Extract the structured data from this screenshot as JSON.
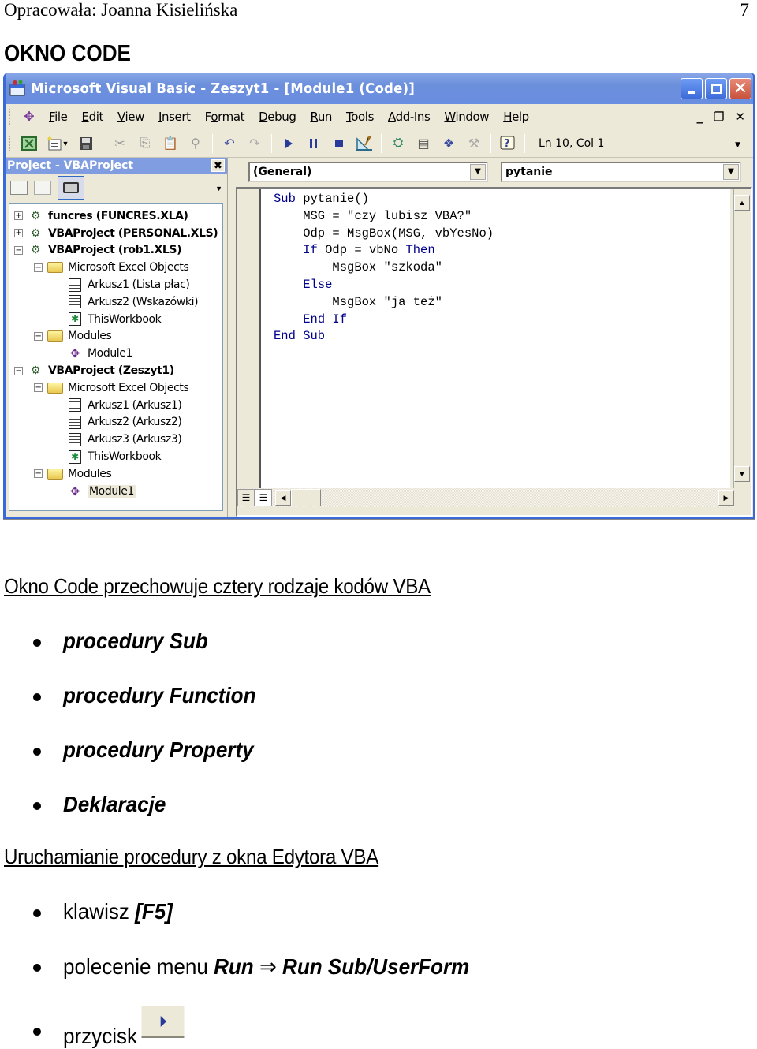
{
  "page": {
    "author": "Opracowała: Joanna Kisielińska",
    "page_number": "7",
    "section_title": "OKNO CODE"
  },
  "vbe": {
    "title": "Microsoft Visual Basic - Zeszyt1 - [Module1 (Code)]",
    "menu": [
      "File",
      "Edit",
      "View",
      "Insert",
      "Format",
      "Debug",
      "Run",
      "Tools",
      "Add-Ins",
      "Window",
      "Help"
    ],
    "menu_access_keys": [
      "F",
      "E",
      "V",
      "I",
      "o",
      "D",
      "R",
      "T",
      "A",
      "W",
      "H"
    ],
    "status": "Ln 10, Col 1",
    "project_pane": {
      "title": "Project - VBAProject",
      "tree": [
        {
          "level": 0,
          "expander": "+",
          "icon": "vba-project-icon",
          "label": "funcres (FUNCRES.XLA)",
          "bold": true
        },
        {
          "level": 0,
          "expander": "+",
          "icon": "vba-project-icon",
          "label": "VBAProject (PERSONAL.XLS)",
          "bold": true
        },
        {
          "level": 0,
          "expander": "-",
          "icon": "vba-project-icon",
          "label": "VBAProject (rob1.XLS)",
          "bold": true
        },
        {
          "level": 1,
          "expander": "-",
          "icon": "folder-icon",
          "label": "Microsoft Excel Objects"
        },
        {
          "level": 2,
          "expander": "",
          "icon": "worksheet-icon",
          "label": "Arkusz1 (Lista płac)"
        },
        {
          "level": 2,
          "expander": "",
          "icon": "worksheet-icon",
          "label": "Arkusz2 (Wskazówki)"
        },
        {
          "level": 2,
          "expander": "",
          "icon": "workbook-icon",
          "label": "ThisWorkbook"
        },
        {
          "level": 1,
          "expander": "-",
          "icon": "folder-icon",
          "label": "Modules"
        },
        {
          "level": 2,
          "expander": "",
          "icon": "module-icon",
          "label": "Module1"
        },
        {
          "level": 0,
          "expander": "-",
          "icon": "vba-project-icon",
          "label": "VBAProject (Zeszyt1)",
          "bold": true
        },
        {
          "level": 1,
          "expander": "-",
          "icon": "folder-icon",
          "label": "Microsoft Excel Objects"
        },
        {
          "level": 2,
          "expander": "",
          "icon": "worksheet-icon",
          "label": "Arkusz1 (Arkusz1)"
        },
        {
          "level": 2,
          "expander": "",
          "icon": "worksheet-icon",
          "label": "Arkusz2 (Arkusz2)"
        },
        {
          "level": 2,
          "expander": "",
          "icon": "worksheet-icon",
          "label": "Arkusz3 (Arkusz3)"
        },
        {
          "level": 2,
          "expander": "",
          "icon": "workbook-icon",
          "label": "ThisWorkbook"
        },
        {
          "level": 1,
          "expander": "-",
          "icon": "folder-icon",
          "label": "Modules"
        },
        {
          "level": 2,
          "expander": "",
          "icon": "module-icon",
          "label": "Module1",
          "selected": true
        }
      ]
    },
    "code_pane": {
      "object_combo": "(General)",
      "procedure_combo": "pytanie",
      "lines": [
        [
          {
            "t": "Sub",
            "kw": true
          },
          {
            "t": " pytanie()"
          }
        ],
        [
          {
            "t": "    MSG = \"czy lubisz VBA?\""
          }
        ],
        [
          {
            "t": "    Odp = MsgBox(MSG, vbYesNo)"
          }
        ],
        [
          {
            "t": "    "
          },
          {
            "t": "If",
            "kw": true
          },
          {
            "t": " Odp = vbNo "
          },
          {
            "t": "Then",
            "kw": true
          }
        ],
        [
          {
            "t": "        MsgBox \"szkoda\""
          }
        ],
        [
          {
            "t": "    "
          },
          {
            "t": "Else",
            "kw": true
          }
        ],
        [
          {
            "t": "        MsgBox \"ja też\""
          }
        ],
        [
          {
            "t": "    "
          },
          {
            "t": "End If",
            "kw": true
          }
        ],
        [
          {
            "t": "End Sub",
            "kw": true
          }
        ]
      ]
    },
    "colors": {
      "titlebar": "#6c8fdc",
      "chrome": "#ece9d8",
      "keyword": "#00008b"
    }
  },
  "doc": {
    "heading1": "Okno Code przechowuje cztery rodzaje kodów VBA",
    "code_types": [
      "procedury Sub",
      "procedury Function",
      "procedury Property",
      "Deklaracje"
    ],
    "heading2": "Uruchamianie procedury z okna Edytora VBA",
    "run_methods": {
      "key_prefix": "klawisz ",
      "key": "[F5]",
      "menu_prefix": "polecenie menu ",
      "menu_run": "Run",
      "menu_arrow": "⇒",
      "menu_item": "Run Sub/UserForm",
      "button_prefix": "przycisk"
    }
  }
}
